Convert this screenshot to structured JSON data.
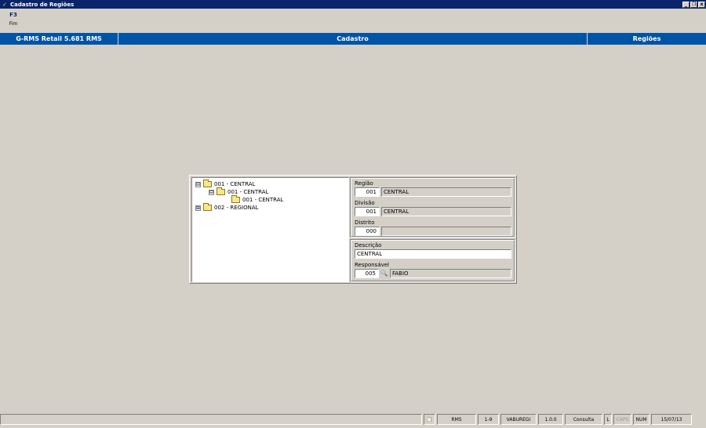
{
  "window": {
    "title": "Cadastro de Regiões",
    "controls": [
      "_",
      "❐",
      "x"
    ]
  },
  "shortcut": {
    "key": "F3",
    "label": "Fim"
  },
  "header": {
    "left": "G-RMS Retail 5.681 RMS",
    "center": "Cadastro",
    "right": "Regiões"
  },
  "tree": {
    "nodes": [
      {
        "expander": "⊟",
        "label": "001 - CENTRAL"
      },
      {
        "expander": "⊟",
        "label": "001 - CENTRAL"
      },
      {
        "expander": "",
        "label": "001 - CENTRAL"
      },
      {
        "expander": "⊞",
        "label": "002 - REGIONAL"
      }
    ]
  },
  "form": {
    "regiao": {
      "label": "Região",
      "code": "001",
      "name": "CENTRAL"
    },
    "divisao": {
      "label": "Divisão",
      "code": "001",
      "name": "CENTRAL"
    },
    "distrito": {
      "label": "Distrito",
      "code": "000",
      "name": ""
    },
    "descricao": {
      "label": "Descrição",
      "value": "CENTRAL"
    },
    "responsavel": {
      "label": "Responsável",
      "code": "005",
      "name": "FABIO",
      "lookup_icon": "binoculars-icon"
    }
  },
  "status": {
    "cells": [
      "RMS",
      "1-9",
      "VABUREGI",
      "1.0.0",
      "Consulta",
      "L",
      "CAPS",
      "NUM",
      "15/07/13"
    ]
  },
  "colors": {
    "titlebar": "#0a246a",
    "header": "#0054a6",
    "background": "#d4d0c8"
  }
}
